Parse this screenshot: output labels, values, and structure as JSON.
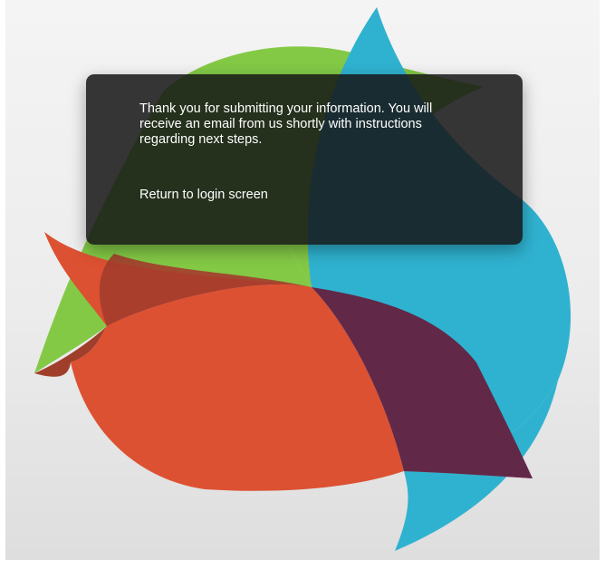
{
  "dialog": {
    "message": "Thank you for submitting your information. You will receive an email from us shortly with instructions regarding next steps.",
    "link_label": "Return to login screen"
  },
  "background": {
    "logo_icon": "swirl-petals-logo",
    "colors": {
      "green": "#83c946",
      "blue": "#2fb2d0",
      "red": "#dc5132",
      "purple": "#622848"
    }
  }
}
